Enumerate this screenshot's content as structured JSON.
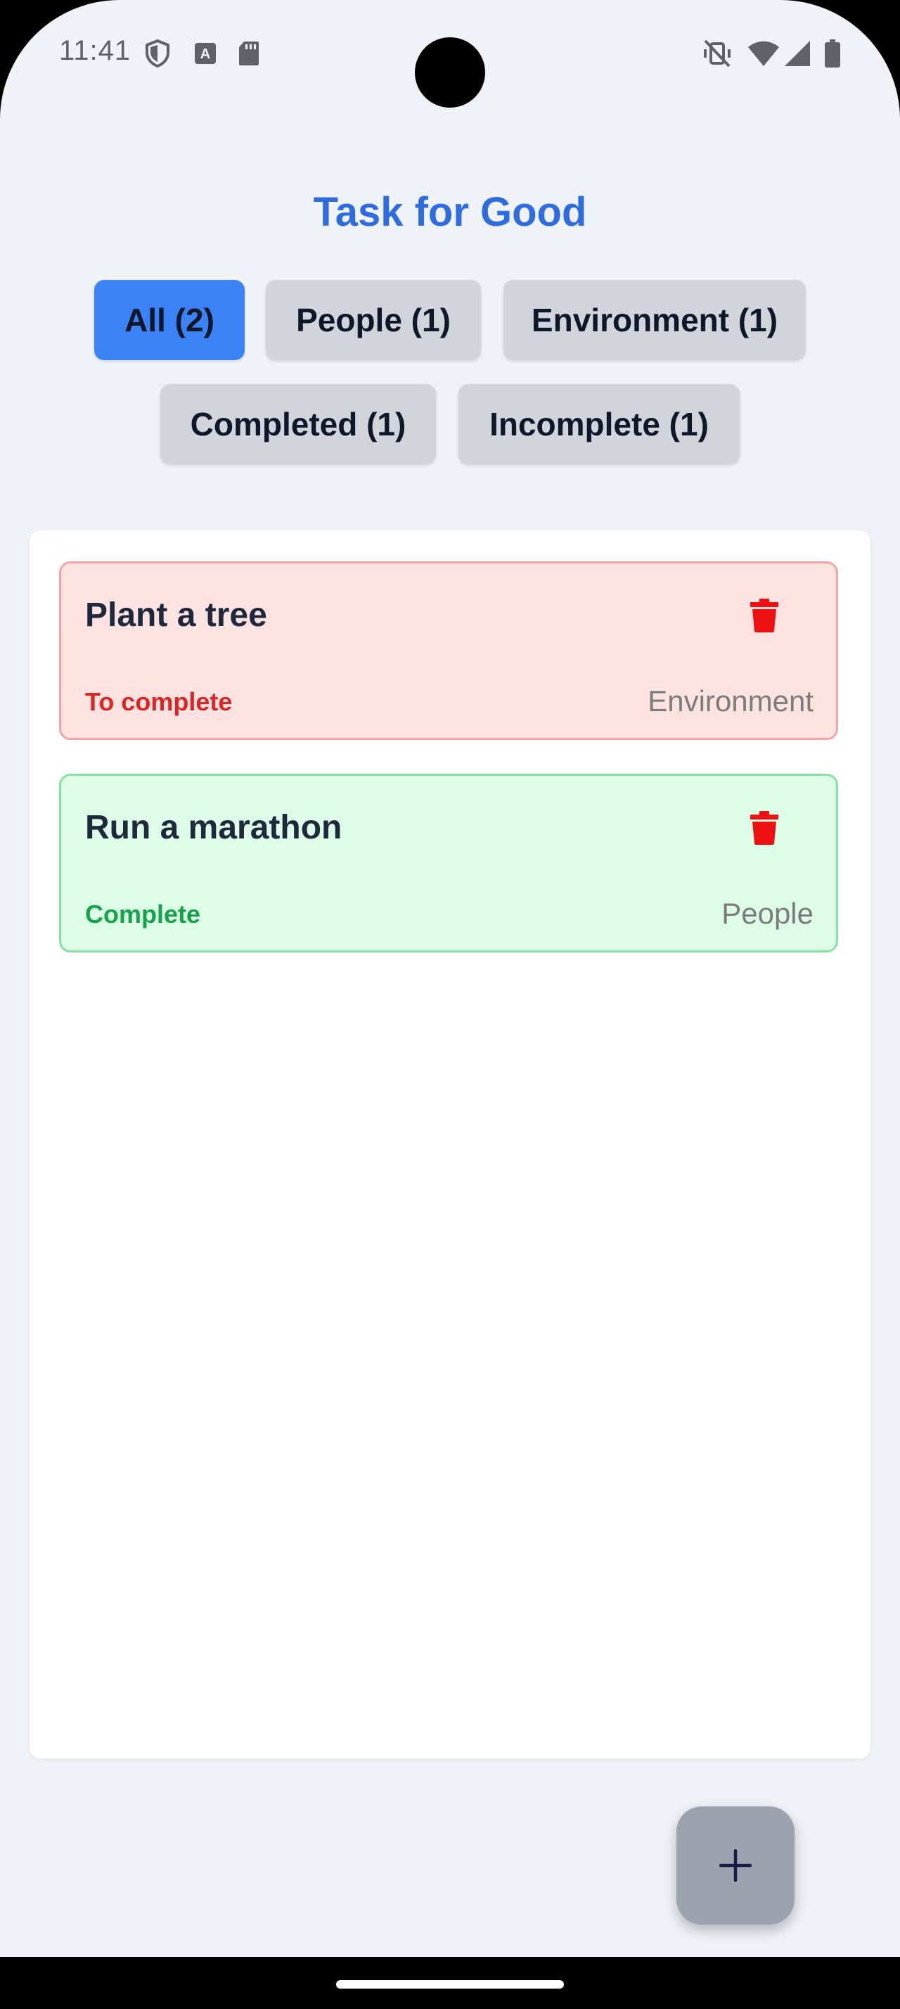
{
  "status_bar": {
    "time": "11:41",
    "left_icons": [
      "shield-icon",
      "font-a-icon",
      "sd-card-icon"
    ],
    "right_icons": [
      "vibrate-off-icon",
      "wifi-icon",
      "signal-icon",
      "battery-icon"
    ]
  },
  "app": {
    "title": "Task for Good"
  },
  "filters": [
    {
      "label": "All (2)",
      "active": true
    },
    {
      "label": "People (1)",
      "active": false
    },
    {
      "label": "Environment (1)",
      "active": false
    },
    {
      "label": "Completed (1)",
      "active": false
    },
    {
      "label": "Incomplete (1)",
      "active": false
    }
  ],
  "tasks": [
    {
      "title": "Plant a tree",
      "status": "To complete",
      "category": "Environment",
      "completed": false
    },
    {
      "title": "Run a marathon",
      "status": "Complete",
      "category": "People",
      "completed": true
    }
  ],
  "fab": {
    "icon": "plus-icon"
  },
  "colors": {
    "accent": "#3b82f6",
    "title": "#2e6ce0",
    "incomplete_bg": "#fde2e2",
    "complete_bg": "#dcfce7",
    "delete": "#ee1111"
  }
}
